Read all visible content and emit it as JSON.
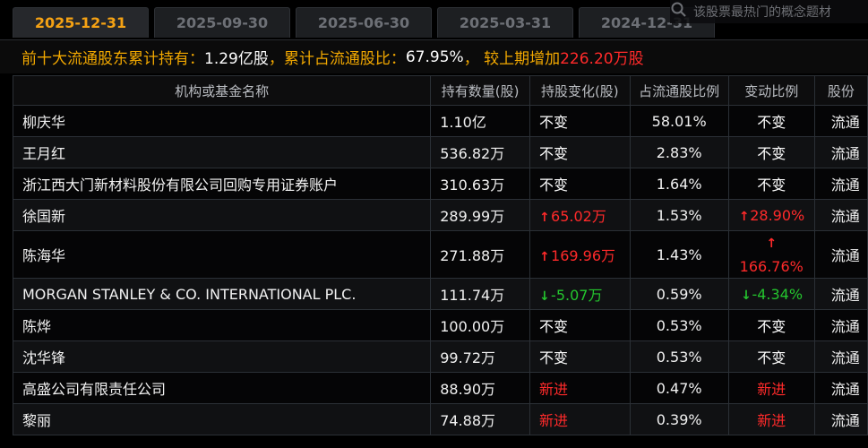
{
  "tabs": [
    "2025-12-31",
    "2025-09-30",
    "2025-06-30",
    "2025-03-31",
    "2024-12-31"
  ],
  "search": {
    "placeholder": "该股票最热门的概念题材"
  },
  "summary": {
    "label1": "前十大流通股东累计持有：",
    "value1": "1.29亿股",
    "label2": "，累计占流通股比：",
    "value2": "67.95%",
    "label3": "， 较上期增加",
    "value3": "226.20万股"
  },
  "table": {
    "headers": [
      "机构或基金名称",
      "持有数量(股)",
      "持股变化(股)",
      "占流通股比例",
      "变动比例",
      "股份"
    ],
    "rows": [
      {
        "name": "柳庆华",
        "qty": "1.10亿",
        "change": "不变",
        "change_dir": "none",
        "pct": "58.01%",
        "ratio": "不变",
        "ratio_dir": "none",
        "type": "流通"
      },
      {
        "name": "王月红",
        "qty": "536.82万",
        "change": "不变",
        "change_dir": "none",
        "pct": "2.83%",
        "ratio": "不变",
        "ratio_dir": "none",
        "type": "流通"
      },
      {
        "name": "浙江西大门新材料股份有限公司回购专用证券账户",
        "qty": "310.63万",
        "change": "不变",
        "change_dir": "none",
        "pct": "1.64%",
        "ratio": "不变",
        "ratio_dir": "none",
        "type": "流通"
      },
      {
        "name": "徐国新",
        "qty": "289.99万",
        "change": "65.02万",
        "change_dir": "up",
        "pct": "1.53%",
        "ratio": "28.90%",
        "ratio_dir": "up",
        "type": "流通"
      },
      {
        "name": "陈海华",
        "qty": "271.88万",
        "change": "169.96万",
        "change_dir": "up",
        "pct": "1.43%",
        "ratio": "166.76%",
        "ratio_dir": "up",
        "type": "流通"
      },
      {
        "name": "MORGAN STANLEY & CO. INTERNATIONAL PLC.",
        "qty": "111.74万",
        "change": "-5.07万",
        "change_dir": "down",
        "pct": "0.59%",
        "ratio": "-4.34%",
        "ratio_dir": "down",
        "type": "流通"
      },
      {
        "name": "陈烨",
        "qty": "100.00万",
        "change": "不变",
        "change_dir": "none",
        "pct": "0.53%",
        "ratio": "不变",
        "ratio_dir": "none",
        "type": "流通"
      },
      {
        "name": "沈华锋",
        "qty": "99.72万",
        "change": "不变",
        "change_dir": "none",
        "pct": "0.53%",
        "ratio": "不变",
        "ratio_dir": "none",
        "type": "流通"
      },
      {
        "name": "高盛公司有限责任公司",
        "qty": "88.90万",
        "change": "新进",
        "change_dir": "new",
        "pct": "0.47%",
        "ratio": "新进",
        "ratio_dir": "new",
        "type": "流通"
      },
      {
        "name": "黎丽",
        "qty": "74.88万",
        "change": "新进",
        "change_dir": "new",
        "pct": "0.39%",
        "ratio": "新进",
        "ratio_dir": "new",
        "type": "流通"
      }
    ]
  },
  "colors": {
    "accent": "#f2a800",
    "up": "#ff2a2a",
    "down": "#24c52e"
  }
}
